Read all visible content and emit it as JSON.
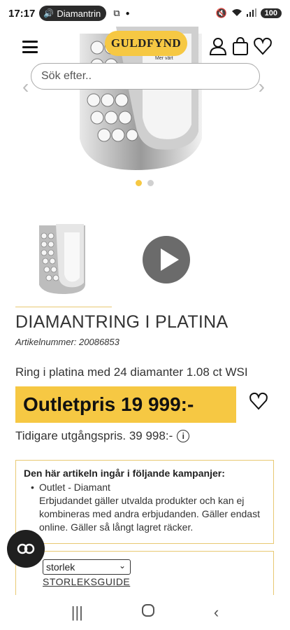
{
  "status_bar": {
    "time": "17:17",
    "media_label": "Diamantrin",
    "battery": "100"
  },
  "header": {
    "logo_text": "GULDFYND",
    "logo_sub": "Mer värt",
    "search_placeholder": "Sök efter.."
  },
  "carousel": {
    "slide_count": 2,
    "active_index": 0
  },
  "product": {
    "title": "DIAMANTRING I PLATINA",
    "article_number": "Artikelnummer: 20086853",
    "description": "Ring i platina med 24 diamanter 1.08 ct WSI",
    "outlet_price": "Outletpris 19 999:-",
    "previous_price": "Tidigare utgångspris. 39 998:-"
  },
  "campaign": {
    "heading": "Den här artikeln ingår i följande kampanjer:",
    "item": "Outlet - Diamant",
    "text": "Erbjudandet gäller utvalda produkter och kan ej kombineras med andra erbjudanden. Gäller endast online. Gäller så långt lagret räcker."
  },
  "size": {
    "select_value": "storlek",
    "guide_label": "STORLEKSGUIDE"
  },
  "colors": {
    "accent": "#f6c843",
    "border_gold": "#e8c872"
  }
}
